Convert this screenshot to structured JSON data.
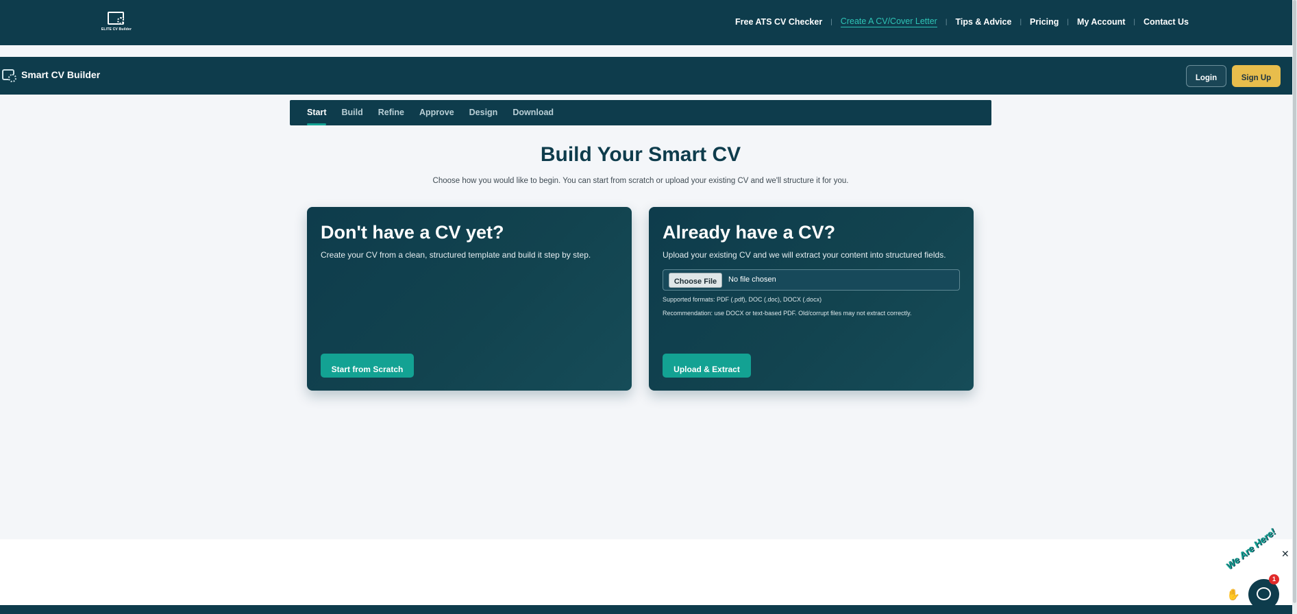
{
  "site_nav": {
    "logo_text": "ELITE CV Builder",
    "links": [
      {
        "label": "Free ATS CV Checker"
      },
      {
        "label": "Create A CV/Cover Letter"
      },
      {
        "label": "Tips & Advice"
      },
      {
        "label": "Pricing"
      },
      {
        "label": "My Account"
      },
      {
        "label": "Contact Us"
      }
    ],
    "active_index": 1,
    "colors": {
      "background": "#0e3c4c",
      "active_link": "#2ec4b6"
    }
  },
  "app_header": {
    "brand": "Smart CV Builder",
    "login_label": "Login",
    "signup_label": "Sign Up",
    "colors": {
      "signup": "#e8bd4c"
    }
  },
  "steps": {
    "items": [
      {
        "label": "Start"
      },
      {
        "label": "Build"
      },
      {
        "label": "Refine"
      },
      {
        "label": "Approve"
      },
      {
        "label": "Design"
      },
      {
        "label": "Download"
      }
    ],
    "active_index": 0
  },
  "main": {
    "title": "Build Your Smart CV",
    "subtitle": "Choose how you would like to begin. You can start from scratch or upload your existing CV and we'll structure it for you."
  },
  "cards": {
    "scratch": {
      "heading": "Don't have a CV yet?",
      "description": "Create your CV from a clean, structured template and build it step by step.",
      "button": "Start from Scratch"
    },
    "upload": {
      "heading": "Already have a CV?",
      "description": "Upload your existing CV and we will extract your content into structured fields.",
      "file_button": "Choose File",
      "file_status": "No file chosen",
      "formats_hint": "Supported formats: PDF (.pdf), DOC (.doc), DOCX (.docx)",
      "recommendation_hint": "Recommendation: use DOCX or text-based PDF. Old/corrupt files may not extract correctly.",
      "button": "Upload & Extract"
    },
    "colors": {
      "button": "#13a293"
    }
  },
  "chat_widget": {
    "tagline": "We Are Here!",
    "badge_count": "1",
    "close_label": "✕"
  }
}
